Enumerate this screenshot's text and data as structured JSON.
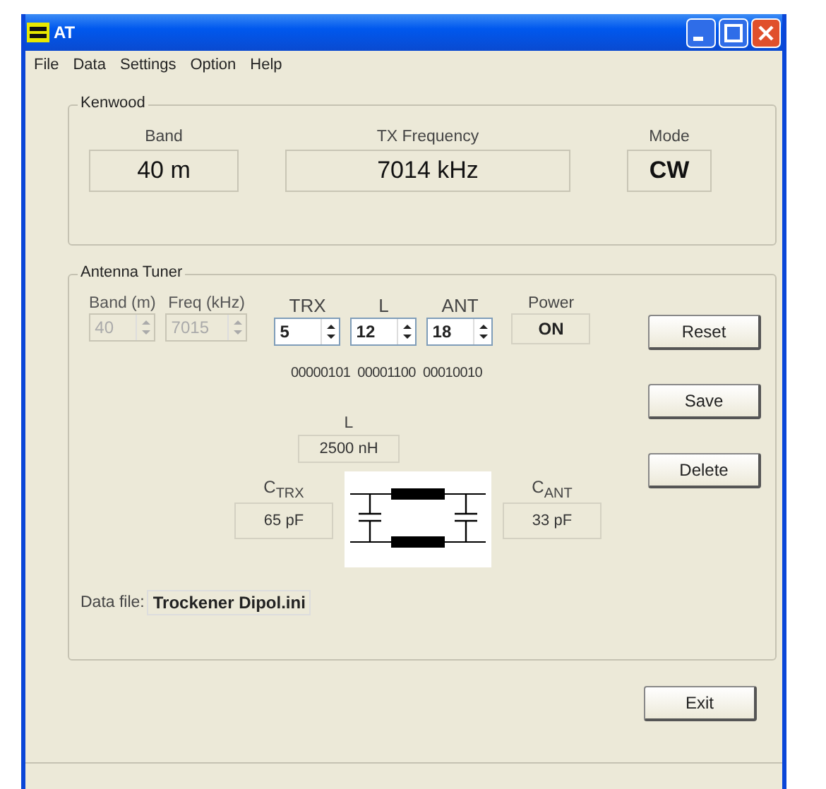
{
  "window": {
    "title": "AT"
  },
  "menu": [
    {
      "label": "File"
    },
    {
      "label": "Data"
    },
    {
      "label": "Settings"
    },
    {
      "label": "Option"
    },
    {
      "label": "Help"
    }
  ],
  "kenwood": {
    "title": "Kenwood",
    "fields": [
      {
        "label": "Band",
        "value": "40 m"
      },
      {
        "label": "TX Frequency",
        "value": "7014 kHz"
      },
      {
        "label": "Mode",
        "value": "CW"
      }
    ]
  },
  "tuner": {
    "title": "Antenna Tuner",
    "spinners": [
      {
        "label": "Band (m)",
        "value": "40",
        "disabled": true
      },
      {
        "label": "Freq (kHz)",
        "value": "7015",
        "disabled": true
      },
      {
        "label": "TRX",
        "value": "5",
        "disabled": false
      },
      {
        "label": "L",
        "value": "12",
        "disabled": false
      },
      {
        "label": "ANT",
        "value": "18",
        "disabled": false
      }
    ],
    "power": {
      "label": "Power",
      "value": "ON"
    },
    "bits": [
      "00000101",
      "00001100",
      "00010010"
    ],
    "inductor": {
      "label": "L",
      "value": "2500 nH"
    },
    "c_trx": {
      "label": "C$_{TRX}$",
      "value": "65 pF"
    },
    "c_ant": {
      "label": "C$_{ANT}$",
      "value": "33 pF"
    },
    "data_file": {
      "label": "Data file:",
      "value": "Trockener Dipol.ini"
    }
  },
  "buttons": [
    {
      "label": "Reset"
    },
    {
      "label": "Save"
    },
    {
      "label": "Delete"
    }
  ],
  "exit": {
    "label": "Exit"
  }
}
